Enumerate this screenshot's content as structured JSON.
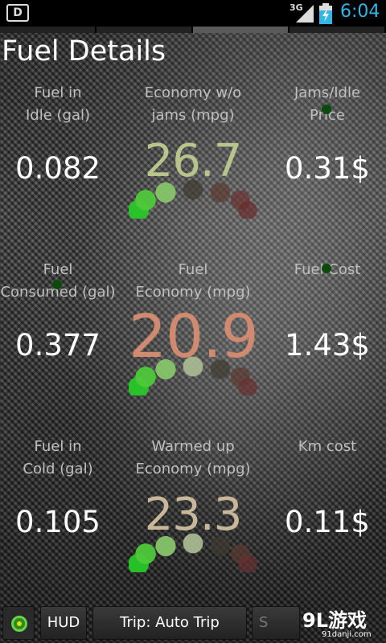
{
  "status_bar": {
    "network": "3G",
    "time": "6:04",
    "app_icon": "D",
    "colors": {
      "time": "#33b5e5"
    }
  },
  "page": {
    "title": "Fuel Details"
  },
  "metrics": [
    {
      "label": "Fuel in\nIdle (gal)",
      "value": "0.082",
      "type": "value"
    },
    {
      "label": "Economy w/o\njams (mpg)",
      "value": "26.7",
      "type": "gauge",
      "color": "#b9c48c",
      "lit_dots": 3
    },
    {
      "label": "Jams/Idle\nPrice",
      "value": "0.31$",
      "type": "value",
      "marker": true
    },
    {
      "label": "Fuel\nConsumed (gal)",
      "value": "0.377",
      "type": "value",
      "marker": true
    },
    {
      "label": "Fuel\nEconomy (mpg)",
      "value": "20.9",
      "type": "gauge",
      "color": "#d08a70",
      "lit_dots": 4
    },
    {
      "label": "Fuel Cost",
      "value": "1.43$",
      "type": "value",
      "marker": true
    },
    {
      "label": "Fuel in\nCold (gal)",
      "value": "0.105",
      "type": "value"
    },
    {
      "label": "Warmed up\nEconomy (mpg)",
      "value": "23.3",
      "type": "gauge",
      "color": "#c9b79a",
      "lit_dots": 4
    },
    {
      "label": "Km cost",
      "value": "0.11$",
      "type": "value"
    }
  ],
  "bottom_bar": {
    "hud_label": "HUD",
    "trip_label": "Trip: Auto Trip",
    "more_label": "S",
    "status_icon": "connection-status-icon"
  },
  "watermark": {
    "main": "9L游戏",
    "sub": "91danji.com"
  }
}
